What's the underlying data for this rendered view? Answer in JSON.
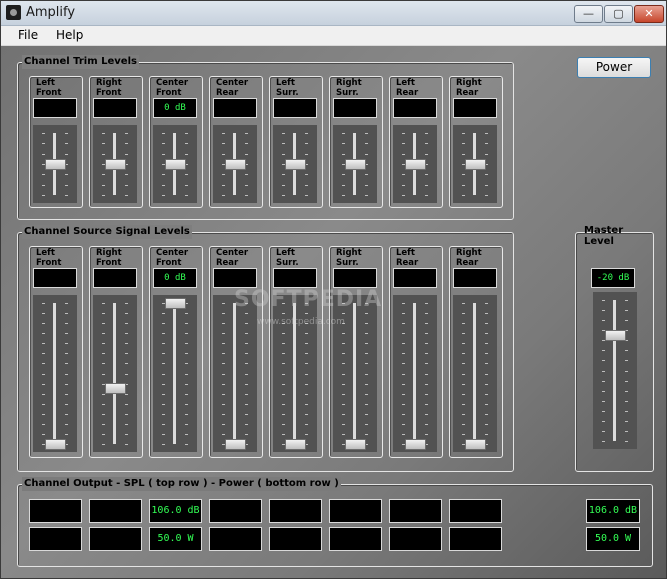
{
  "window": {
    "title": "Amplify",
    "controls": {
      "minimize": "—",
      "maximize": "▢",
      "close": "✕"
    }
  },
  "menu": {
    "file": "File",
    "help": "Help"
  },
  "power_button": "Power",
  "trim_group": {
    "title": "Channel Trim Levels",
    "channels": [
      {
        "label": "Left\nFront",
        "readout": "",
        "level": 0.5
      },
      {
        "label": "Right\nFront",
        "readout": "",
        "level": 0.5
      },
      {
        "label": "Center\nFront",
        "readout": "0 dB",
        "level": 0.5
      },
      {
        "label": "Center\nRear",
        "readout": "",
        "level": 0.5
      },
      {
        "label": "Left\nSurr.",
        "readout": "",
        "level": 0.5
      },
      {
        "label": "Right\nSurr.",
        "readout": "",
        "level": 0.5
      },
      {
        "label": "Left\nRear",
        "readout": "",
        "level": 0.5
      },
      {
        "label": "Right\nRear",
        "readout": "",
        "level": 0.5
      }
    ]
  },
  "source_group": {
    "title": "Channel Source Signal Levels",
    "channels": [
      {
        "label": "Left\nFront",
        "readout": "",
        "level": 0.0
      },
      {
        "label": "Right\nFront",
        "readout": "",
        "level": 0.4
      },
      {
        "label": "Center\nFront",
        "readout": "0 dB",
        "level": 1.0
      },
      {
        "label": "Center\nRear",
        "readout": "",
        "level": 0.0
      },
      {
        "label": "Left\nSurr.",
        "readout": "",
        "level": 0.0
      },
      {
        "label": "Right\nSurr.",
        "readout": "",
        "level": 0.0
      },
      {
        "label": "Left\nRear",
        "readout": "",
        "level": 0.0
      },
      {
        "label": "Right\nRear",
        "readout": "",
        "level": 0.0
      }
    ]
  },
  "master": {
    "title": "Master\nLevel",
    "readout": "-20 dB",
    "level": 0.75
  },
  "output_group": {
    "title": "Channel Output  -  SPL ( top row )  -  Power ( bottom row )",
    "spl": [
      "",
      "",
      "106.0 dB",
      "",
      "",
      "",
      "",
      ""
    ],
    "power": [
      "",
      "",
      "50.0 W",
      "",
      "",
      "",
      "",
      ""
    ],
    "master_spl": "106.0 dB",
    "master_power": "50.0 W"
  },
  "watermark": {
    "text": "SOFTPEDIA",
    "url": "www.softpedia.com"
  }
}
